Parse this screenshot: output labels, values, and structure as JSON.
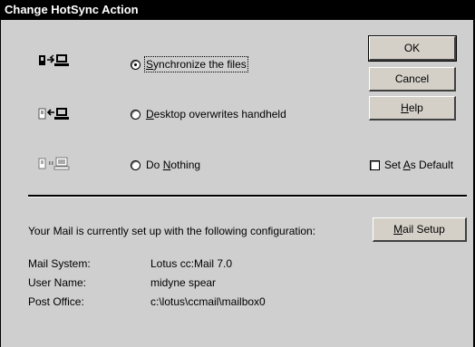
{
  "window": {
    "title": "Change HotSync Action"
  },
  "options": [
    {
      "label_pre": "",
      "label_accel": "S",
      "label_post": "ynchronize the files",
      "selected": true,
      "icon": "sync-both-ways-icon"
    },
    {
      "label_pre": "",
      "label_accel": "D",
      "label_post": "esktop overwrites handheld",
      "selected": false,
      "icon": "desktop-to-handheld-icon"
    },
    {
      "label_pre": "Do ",
      "label_accel": "N",
      "label_post": "othing",
      "selected": false,
      "icon": "do-nothing-icon"
    }
  ],
  "buttons": {
    "ok": "OK",
    "cancel": "Cancel",
    "help_accel": "H",
    "help_rest": "elp",
    "mail_setup_accel": "M",
    "mail_setup_rest": "ail Setup"
  },
  "default_checkbox": {
    "pre": "Set ",
    "accel": "A",
    "post": "s Default",
    "checked": false
  },
  "mail": {
    "intro": "Your Mail is currently set up with the following configuration:",
    "fields": [
      {
        "key": "Mail System:",
        "value": "Lotus cc:Mail 7.0"
      },
      {
        "key": "User Name:",
        "value": "midyne spear"
      },
      {
        "key": "Post Office:",
        "value": "c:\\lotus\\ccmail\\mailbox0"
      }
    ]
  }
}
